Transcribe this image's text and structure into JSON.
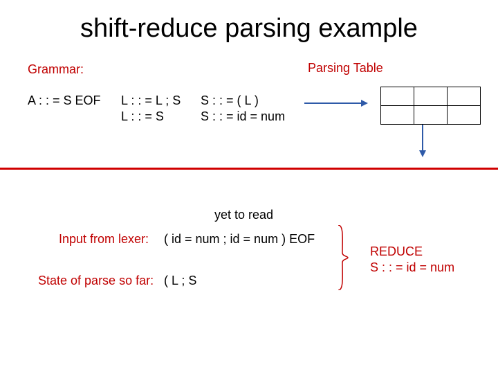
{
  "title": "shift-reduce parsing example",
  "labels": {
    "grammar": "Grammar:",
    "parsing_table": "Parsing Table",
    "yet_to_read": "yet to read",
    "input_from_lexer": "Input from lexer:",
    "state_of_parse": "State of parse so far:",
    "reduce": "REDUCE",
    "reduce_rule": "S : : = id = num"
  },
  "productions": {
    "A": "A : : = S EOF",
    "L1": "L : : = L ; S",
    "L2": "L : : = S",
    "S1": "S : : = ( L )",
    "S2": "S : : = id = num"
  },
  "input_stream": "( id = num ; id = num ) EOF",
  "parse_state": "( L ; S"
}
